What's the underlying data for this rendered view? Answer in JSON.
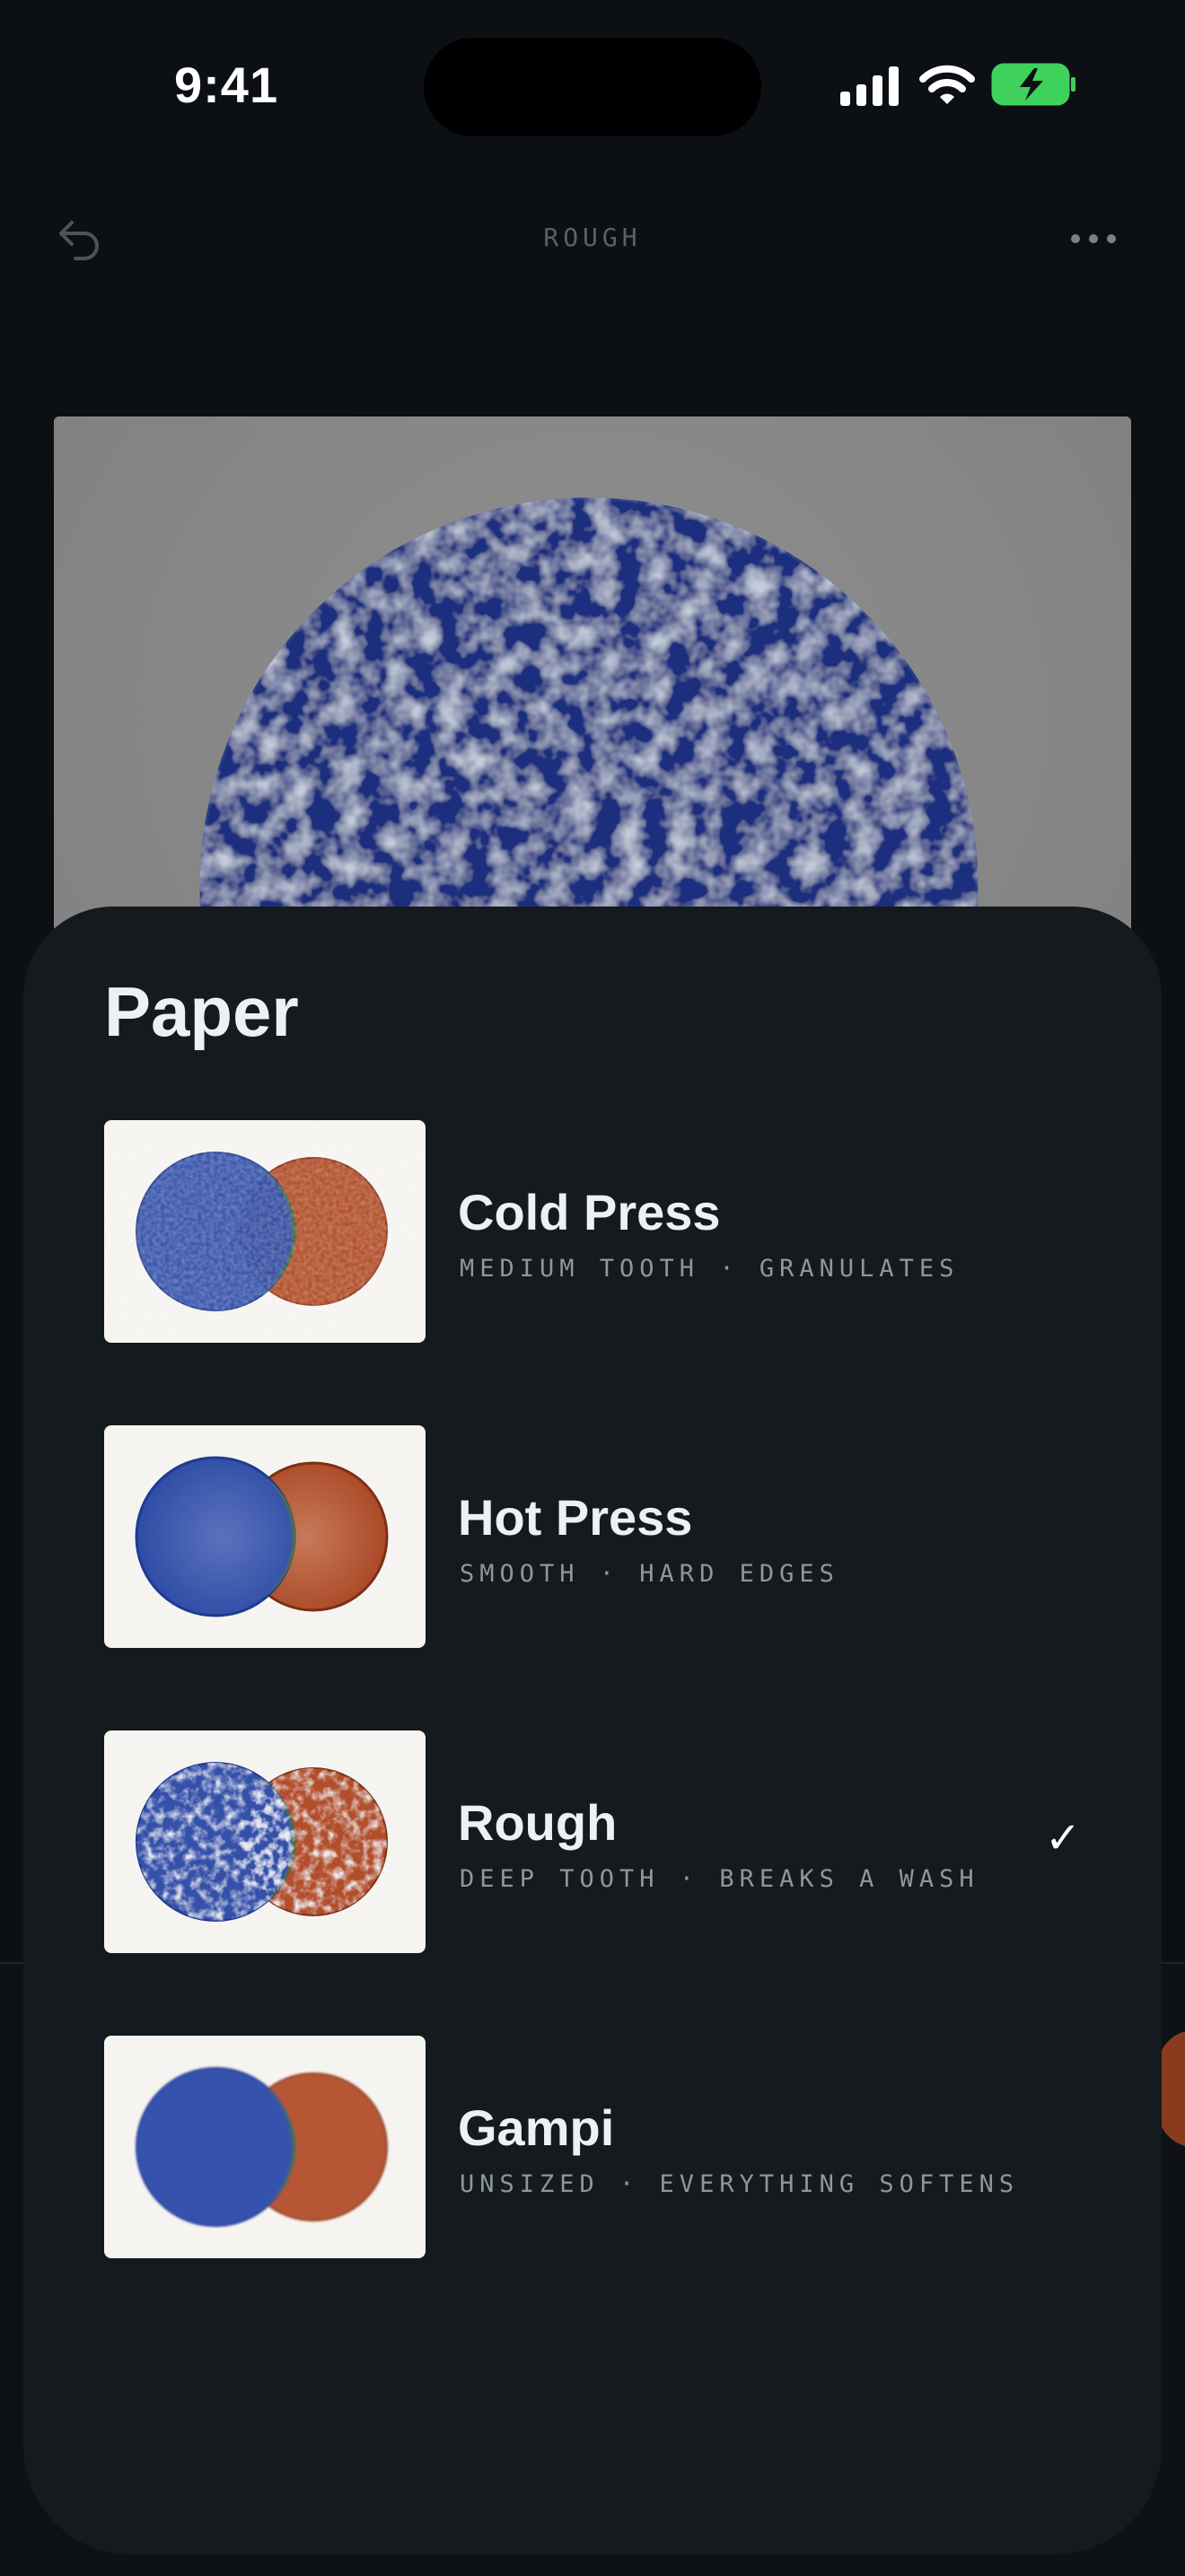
{
  "status": {
    "time": "9:41"
  },
  "header": {
    "title": "ROUGH",
    "undo_icon": "undo-icon",
    "more_icon": "more-icon"
  },
  "sheet": {
    "title": "Paper",
    "options": [
      {
        "name": "Cold Press",
        "desc": "MEDIUM TOOTH · GRANULATES",
        "selected": false
      },
      {
        "name": "Hot Press",
        "desc": "SMOOTH · HARD EDGES",
        "selected": false
      },
      {
        "name": "Rough",
        "desc": "DEEP TOOTH · BREAKS A WASH",
        "selected": true
      },
      {
        "name": "Gampi",
        "desc": "UNSIZED · EVERYTHING SOFTENS",
        "selected": false
      }
    ],
    "selected_mark": "✓"
  },
  "colors": {
    "blue": "#2f4fa8",
    "rust": "#b24e2b",
    "battery": "#3ed15b",
    "sheet_bg": "#141a1e"
  }
}
